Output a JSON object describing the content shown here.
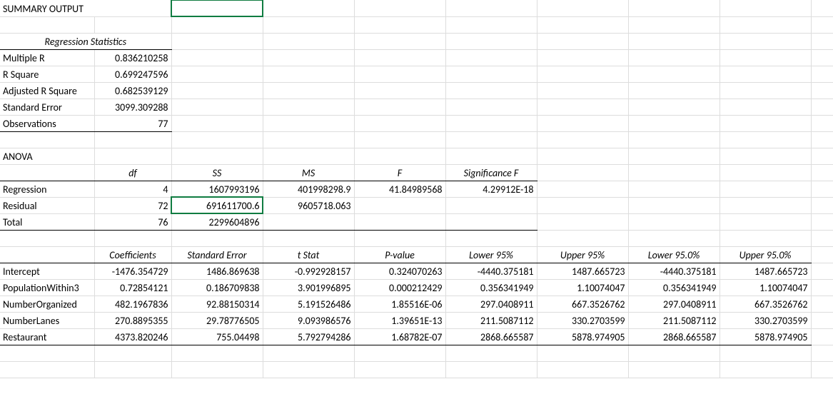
{
  "title": "SUMMARY OUTPUT",
  "regStatsHeader": "Regression Statistics",
  "regStats": {
    "multipleR": {
      "label": "Multiple R",
      "value": "0.836210258"
    },
    "rSquare": {
      "label": "R Square",
      "value": "0.699247596"
    },
    "adjRSquare": {
      "label": "Adjusted R Square",
      "value": "0.682539129"
    },
    "stdErr": {
      "label": "Standard Error",
      "value": "3099.309288"
    },
    "obs": {
      "label": "Observations",
      "value": "77"
    }
  },
  "anovaHeader": "ANOVA",
  "anovaCols": {
    "df": "df",
    "ss": "SS",
    "ms": "MS",
    "f": "F",
    "sigF": "Significance F"
  },
  "anova": {
    "regression": {
      "label": "Regression",
      "df": "4",
      "ss": "1607993196",
      "ms": "401998298.9",
      "f": "41.84989568",
      "sigF": "4.29912E-18"
    },
    "residual": {
      "label": "Residual",
      "df": "72",
      "ss": "691611700.6",
      "ms": "9605718.063",
      "f": "",
      "sigF": ""
    },
    "total": {
      "label": "Total",
      "df": "76",
      "ss": "2299604896",
      "ms": "",
      "f": "",
      "sigF": ""
    }
  },
  "coeffCols": {
    "coef": "Coefficients",
    "se": "Standard Error",
    "tstat": "t Stat",
    "pval": "P-value",
    "l95": "Lower 95%",
    "u95": "Upper 95%",
    "l95b": "Lower 95.0%",
    "u95b": "Upper 95.0%"
  },
  "coeffs": {
    "intercept": {
      "label": "Intercept",
      "coef": "-1476.354729",
      "se": "1486.869638",
      "tstat": "-0.992928157",
      "pval": "0.324070263",
      "l95": "-4440.375181",
      "u95": "1487.665723",
      "l95b": "-4440.375181",
      "u95b": "1487.665723"
    },
    "pop": {
      "label": "PopulationWithin3",
      "coef": "0.72854121",
      "se": "0.186709838",
      "tstat": "3.901996895",
      "pval": "0.000212429",
      "l95": "0.356341949",
      "u95": "1.10074047",
      "l95b": "0.356341949",
      "u95b": "1.10074047"
    },
    "norg": {
      "label": "NumberOrganized",
      "coef": "482.1967836",
      "se": "92.88150314",
      "tstat": "5.191526486",
      "pval": "1.85516E-06",
      "l95": "297.0408911",
      "u95": "667.3526762",
      "l95b": "297.0408911",
      "u95b": "667.3526762"
    },
    "lanes": {
      "label": "NumberLanes",
      "coef": "270.8895355",
      "se": "29.78776505",
      "tstat": "9.093986576",
      "pval": "1.39651E-13",
      "l95": "211.5087112",
      "u95": "330.2703599",
      "l95b": "211.5087112",
      "u95b": "330.2703599"
    },
    "rest": {
      "label": "Restaurant",
      "coef": "4373.820246",
      "se": "755.04498",
      "tstat": "5.792794286",
      "pval": "1.68782E-07",
      "l95": "2868.665587",
      "u95": "5878.974905",
      "l95b": "2868.665587",
      "u95b": "5878.974905"
    }
  }
}
